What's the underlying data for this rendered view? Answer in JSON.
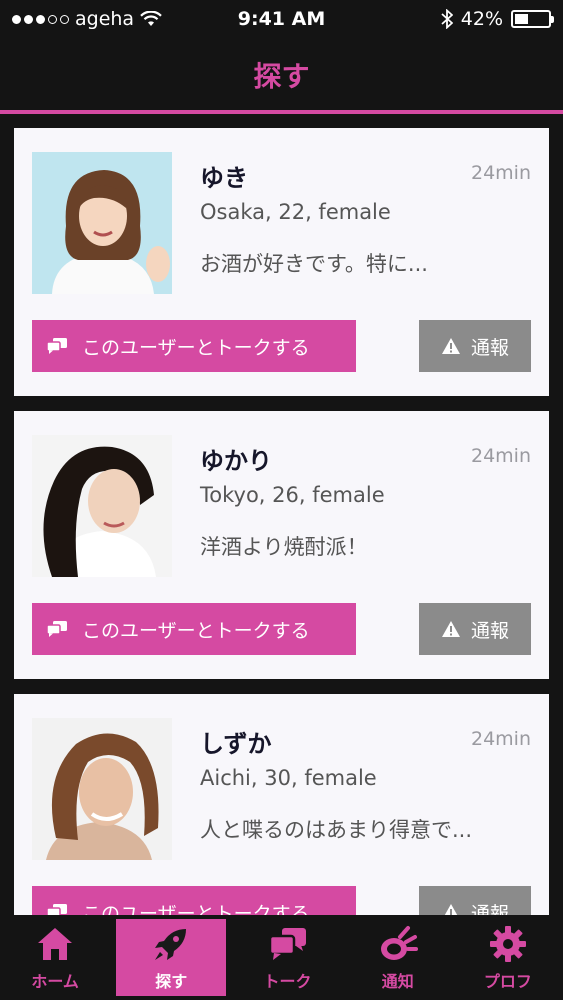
{
  "status_bar": {
    "carrier": "ageha",
    "time": "9:41 AM",
    "battery": "42%",
    "battery_level": 0.42
  },
  "header": {
    "title": "探す"
  },
  "colors": {
    "accent": "#d54aa2",
    "report": "#8b8b8b",
    "card": "#f8f7fb"
  },
  "users": [
    {
      "name": "ゆき",
      "time": "24min",
      "meta": "Osaka, 22, female",
      "message": "お酒が好きです。特に...",
      "talk_label": "このユーザーとトークする",
      "report_label": "通報"
    },
    {
      "name": "ゆかり",
      "time": "24min",
      "meta": "Tokyo, 26, female",
      "message": "洋酒より焼酎派！",
      "talk_label": "このユーザーとトークする",
      "report_label": "通報"
    },
    {
      "name": "しずか",
      "time": "24min",
      "meta": "Aichi, 30, female",
      "message": "人と喋るのはあまり得意で...",
      "talk_label": "このユーザーとトークする",
      "report_label": "通報"
    }
  ],
  "tabs": [
    {
      "label": "ホーム",
      "icon": "home-icon",
      "active": false
    },
    {
      "label": "探す",
      "icon": "rocket-icon",
      "active": true
    },
    {
      "label": "トーク",
      "icon": "chat-icon",
      "active": false
    },
    {
      "label": "通知",
      "icon": "megaphone-icon",
      "active": false
    },
    {
      "label": "プロフ",
      "icon": "gear-icon",
      "active": false
    }
  ]
}
